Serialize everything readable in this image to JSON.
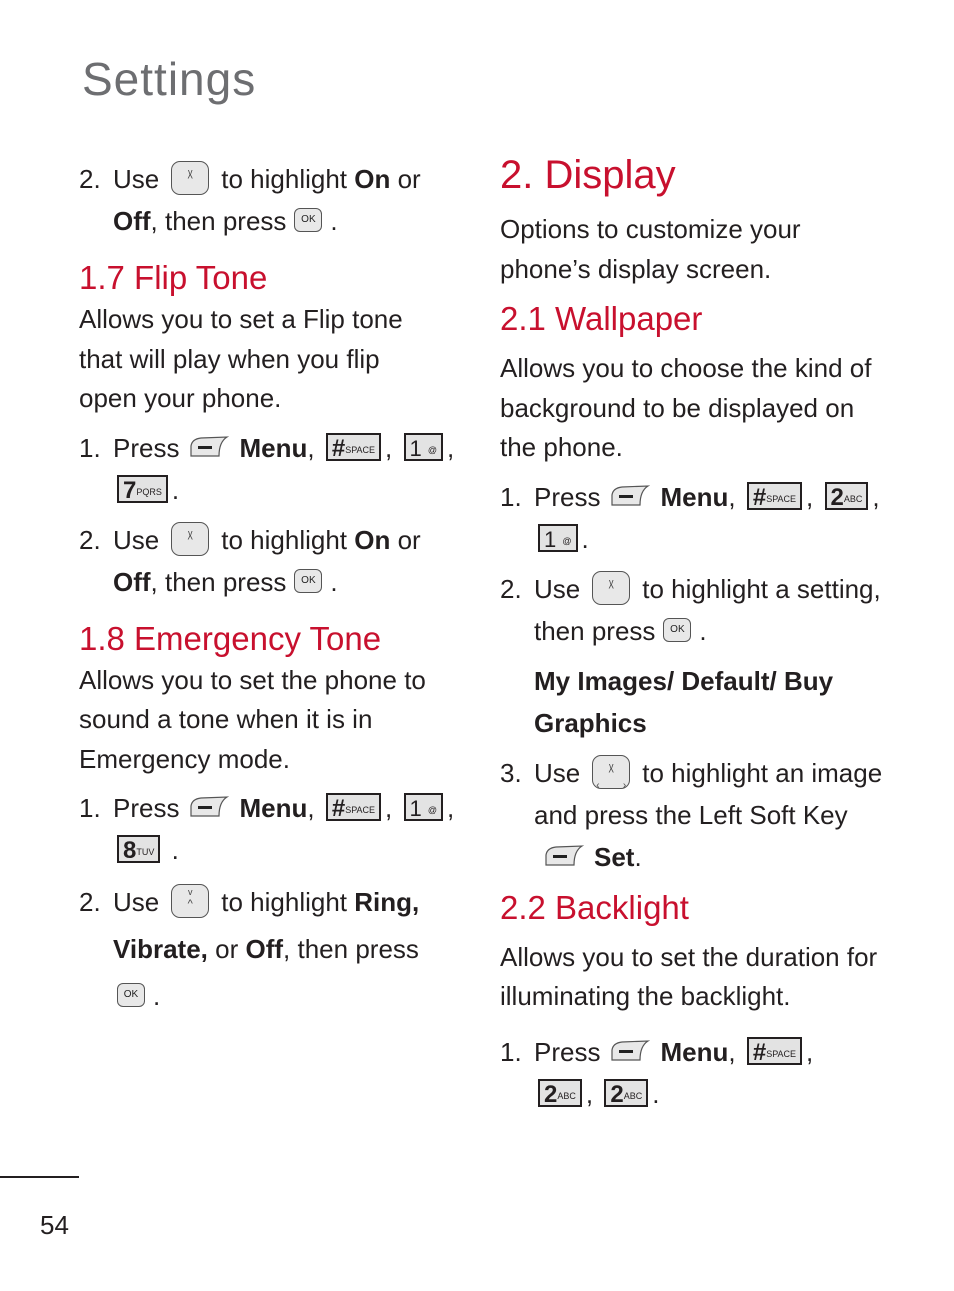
{
  "page": {
    "title": "Settings",
    "number": "54"
  },
  "colors": {
    "heading": "#c8102e",
    "title": "#6d6e71",
    "text": "#231f20"
  },
  "icons": {
    "nav_key": "up-down-navigation-key-icon",
    "nav4_key": "four-way-navigation-key-icon",
    "ok_key": "ok-key-icon",
    "left_soft_key": "left-soft-key-icon",
    "hash_key": "hash-space-key-icon",
    "one_key": "1-voicemail-key-icon",
    "two_key": "2-abc-key-icon",
    "seven_key": "7-pqrs-key-icon",
    "eight_key": "8-tuv-key-icon"
  },
  "keys": {
    "ok": "OK",
    "hash": "#",
    "hash_sub": "SPACE",
    "one": "1",
    "two": "2",
    "two_sub": "ABC",
    "seven": "7",
    "seven_sub": "PQRS",
    "eight": "8",
    "eight_sub": "TUV"
  },
  "left": {
    "step_prev": {
      "num": "2.",
      "use": "Use",
      "highlight": "to highlight",
      "on": "On",
      "or": "or",
      "off": "Off",
      "then": ", then press",
      "end": "."
    },
    "flip_tone": {
      "heading": "1.7 Flip Tone",
      "desc": "Allows you to set a Flip tone that will play when you flip open your phone.",
      "step1": {
        "num": "1.",
        "press": "Press",
        "menu": "Menu",
        "comma": ",",
        "end": "."
      },
      "step2": {
        "num": "2.",
        "use": "Use",
        "highlight": "to highlight",
        "on": "On",
        "or": "or",
        "off": "Off",
        "then": ", then press",
        "end": "."
      }
    },
    "emergency_tone": {
      "heading": "1.8 Emergency Tone",
      "desc": "Allows you to set the phone to sound a tone when it is in Emergency mode.",
      "step1": {
        "num": "1.",
        "press": "Press",
        "menu": "Menu",
        "comma": ",",
        "end": "."
      },
      "step2": {
        "num": "2.",
        "use": "Use",
        "highlight": "to highlight",
        "ring": "Ring,",
        "vibrate": "Vibrate,",
        "or": "or",
        "off": "Off",
        "then": ", then press",
        "end": "."
      }
    }
  },
  "right": {
    "display": {
      "heading": "2. Display",
      "desc": "Options to customize your phone’s display screen."
    },
    "wallpaper": {
      "heading": "2.1 Wallpaper",
      "desc": "Allows you to choose the kind of background to be displayed on the phone.",
      "step1": {
        "num": "1.",
        "press": "Press",
        "menu": "Menu",
        "comma": ",",
        "end": "."
      },
      "step2": {
        "num": "2.",
        "use": "Use",
        "highlight": "to highlight a setting, then press",
        "end": "."
      },
      "options": "My Images/ Default/ Buy Graphics",
      "step3": {
        "num": "3.",
        "use": "Use",
        "text": "to highlight an image and press the Left Soft Key",
        "set": "Set",
        "end": "."
      }
    },
    "backlight": {
      "heading": "2.2 Backlight",
      "desc": "Allows you to set the duration for illuminating the backlight.",
      "step1": {
        "num": "1.",
        "press": "Press",
        "menu": "Menu",
        "comma": ",",
        "end": "."
      }
    }
  }
}
